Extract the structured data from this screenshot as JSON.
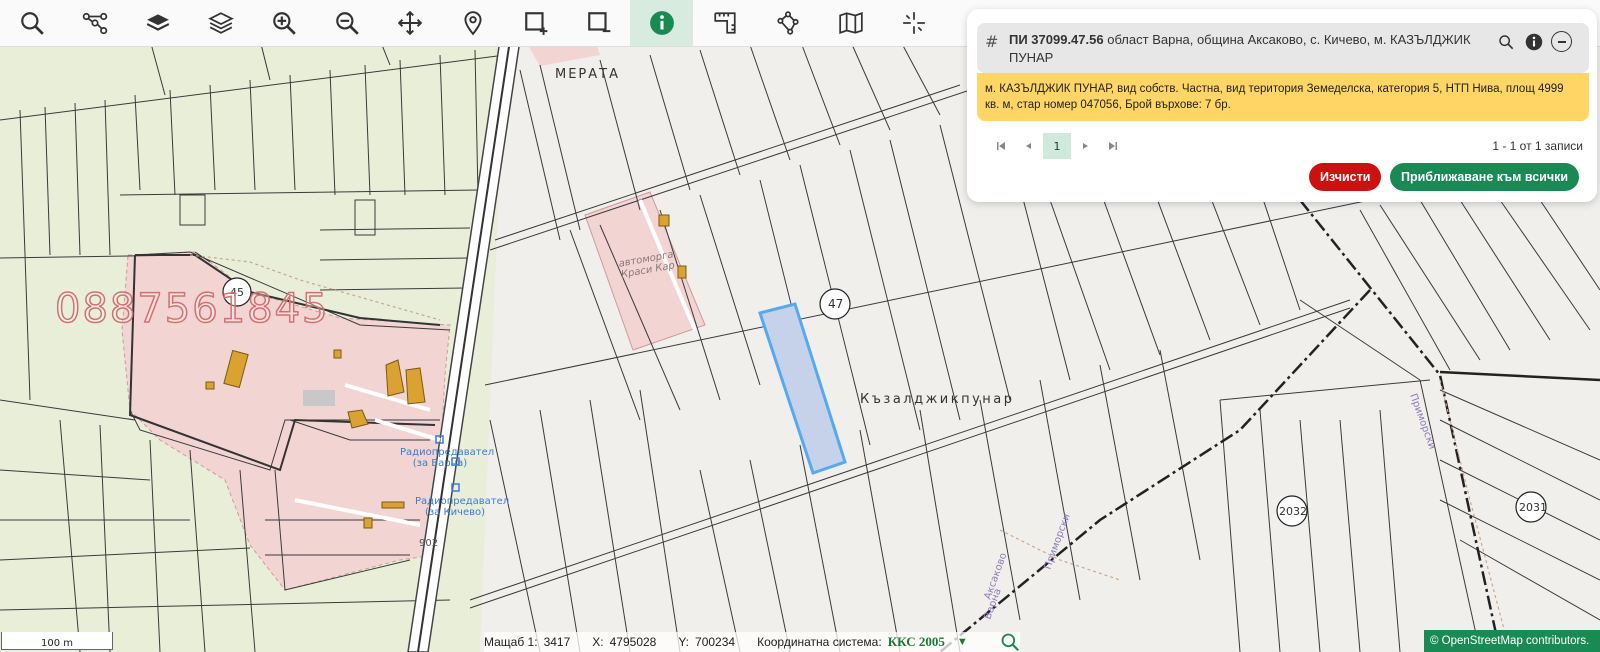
{
  "toolbar": {
    "tools": [
      {
        "name": "search-tool",
        "icon": "search-icon"
      },
      {
        "name": "route-tool",
        "icon": "network-icon"
      },
      {
        "name": "layers-tool",
        "icon": "layers-filled-icon"
      },
      {
        "name": "layers-outline-tool",
        "icon": "layers-outline-icon"
      },
      {
        "name": "zoom-in-tool",
        "icon": "zoom-in-icon"
      },
      {
        "name": "zoom-out-tool",
        "icon": "zoom-out-icon"
      },
      {
        "name": "pan-tool",
        "icon": "move-icon"
      },
      {
        "name": "location-tool",
        "icon": "map-pin-icon"
      },
      {
        "name": "select-add-tool",
        "icon": "select-add-icon"
      },
      {
        "name": "select-remove-tool",
        "icon": "select-remove-icon"
      },
      {
        "name": "info-tool",
        "icon": "info-icon",
        "active": true
      },
      {
        "name": "measure-tool",
        "icon": "ruler-icon"
      },
      {
        "name": "polygon-tool",
        "icon": "polygon-icon"
      },
      {
        "name": "map-tool",
        "icon": "folded-map-icon"
      },
      {
        "name": "coordinates-tool",
        "icon": "crosshair-icon"
      }
    ],
    "active_color": "#1a8a55"
  },
  "panel": {
    "title_id": "ПИ 37099.47.56",
    "title_rest": "област Варна, община Аксаково, с. Кичево, м. КАЗЪЛДЖИК ПУНАР",
    "description": "м. КАЗЪЛДЖИК ПУНАР, вид собств. Частна, вид територия Земеделска, категория 5, НТП Нива, площ 4999 кв. м, стар номер 047056, Брой върхове: 7 бр.",
    "page_current": "1",
    "records": "1 - 1 от 1 записи",
    "clear_label": "Изчисти",
    "zoom_all_label": "Приближаване към всички",
    "desc_color": "#ffd666",
    "clear_color": "#cc1111",
    "zoom_color": "#1a8a55"
  },
  "map": {
    "labels": {
      "merata": "МЕРАТА",
      "kazaldzhik": "Къзалджикпунар",
      "avtomorga": "автоморга Краси Кар",
      "radio1": "Радиопредавател (за Варна)",
      "radio2": "Радиопредавател (за Кичево)",
      "num45": "45",
      "num47": "47",
      "num2032": "2032",
      "num2031": "2031",
      "num902": "902"
    },
    "phone_watermark": "0887561845",
    "colors": {
      "agricultural": "#e9eed9",
      "urban": "#f2d4d3",
      "parcel_bg": "#f1efec",
      "selected_fill": "#c6d2ea",
      "selected_stroke": "#55a9ef"
    }
  },
  "status": {
    "scale_bar": "100 m",
    "scale_label": "Мащаб 1:",
    "scale_value": "3417",
    "x_label": "X:",
    "x_value": "4795028",
    "y_label": "Y:",
    "y_value": "700234",
    "crs_label": "Координатна система:",
    "crs_value": "ККС 2005",
    "attribution": "© OpenStreetMap contributors."
  }
}
